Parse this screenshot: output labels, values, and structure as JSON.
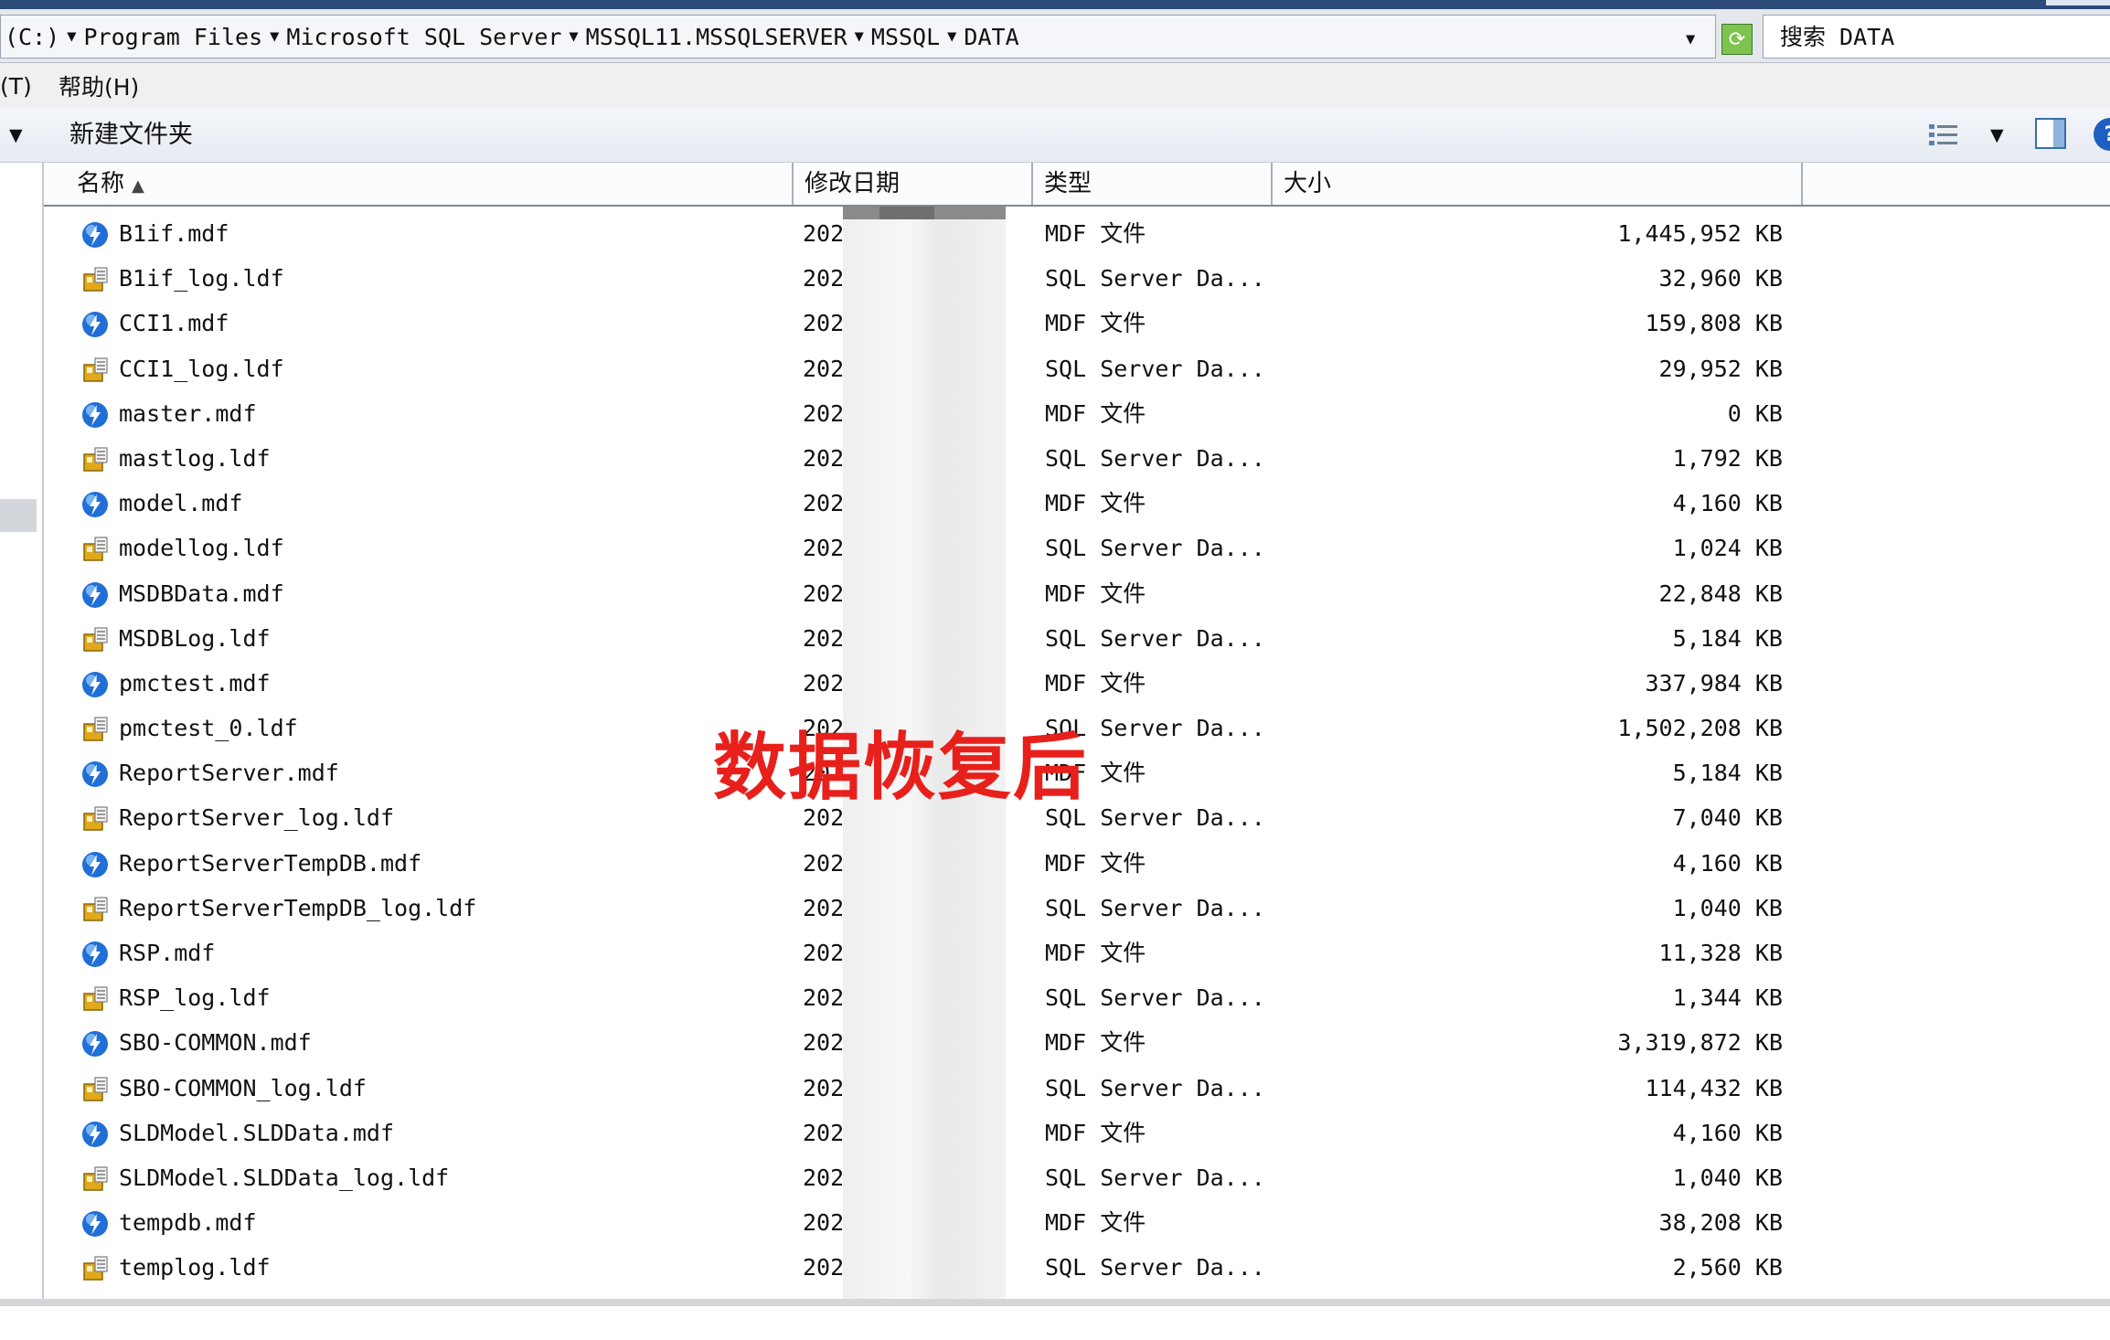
{
  "address": {
    "crumbs": [
      "(C:)",
      "Program Files",
      "Microsoft SQL Server",
      "MSSQL11.MSSQLSERVER",
      "MSSQL",
      "DATA"
    ]
  },
  "search": {
    "value": "搜索 DATA"
  },
  "menu": {
    "tools": "(T)",
    "help": "帮助(H)"
  },
  "toolbar": {
    "new_folder": "新建文件夹"
  },
  "columns": {
    "name": "名称",
    "date": "修改日期",
    "type": "类型",
    "size": "大小"
  },
  "files": [
    {
      "name": "B1if.mdf",
      "date": "202",
      "type": "MDF 文件",
      "size": "1,445,952 KB",
      "icon": "mdf-database-icon"
    },
    {
      "name": "B1if_log.ldf",
      "date": "202",
      "type": "SQL Server Da...",
      "size": "32,960 KB",
      "icon": "ldf-log-icon"
    },
    {
      "name": "CCI1.mdf",
      "date": "202",
      "type": "MDF 文件",
      "size": "159,808 KB",
      "icon": "mdf-database-icon"
    },
    {
      "name": "CCI1_log.ldf",
      "date": "202",
      "type": "SQL Server Da...",
      "size": "29,952 KB",
      "icon": "ldf-log-icon"
    },
    {
      "name": "master.mdf",
      "date": "202",
      "type": "MDF 文件",
      "size": "0 KB",
      "icon": "mdf-database-icon"
    },
    {
      "name": "mastlog.ldf",
      "date": "202",
      "type": "SQL Server Da...",
      "size": "1,792 KB",
      "icon": "ldf-log-icon"
    },
    {
      "name": "model.mdf",
      "date": "202",
      "type": "MDF 文件",
      "size": "4,160 KB",
      "icon": "mdf-database-icon"
    },
    {
      "name": "modellog.ldf",
      "date": "202",
      "type": "SQL Server Da...",
      "size": "1,024 KB",
      "icon": "ldf-log-icon"
    },
    {
      "name": "MSDBData.mdf",
      "date": "202",
      "type": "MDF 文件",
      "size": "22,848 KB",
      "icon": "mdf-database-icon"
    },
    {
      "name": "MSDBLog.ldf",
      "date": "202",
      "type": "SQL Server Da...",
      "size": "5,184 KB",
      "icon": "ldf-log-icon"
    },
    {
      "name": "pmctest.mdf",
      "date": "202",
      "type": "MDF 文件",
      "size": "337,984 KB",
      "icon": "mdf-database-icon"
    },
    {
      "name": "pmctest_0.ldf",
      "date": "202",
      "type": "SQL Server Da...",
      "size": "1,502,208 KB",
      "icon": "ldf-log-icon"
    },
    {
      "name": "ReportServer.mdf",
      "date": "202",
      "type": "MDF 文件",
      "size": "5,184 KB",
      "icon": "mdf-database-icon"
    },
    {
      "name": "ReportServer_log.ldf",
      "date": "202",
      "type": "SQL Server Da...",
      "size": "7,040 KB",
      "icon": "ldf-log-icon"
    },
    {
      "name": "ReportServerTempDB.mdf",
      "date": "202",
      "type": "MDF 文件",
      "size": "4,160 KB",
      "icon": "mdf-database-icon"
    },
    {
      "name": "ReportServerTempDB_log.ldf",
      "date": "202",
      "type": "SQL Server Da...",
      "size": "1,040 KB",
      "icon": "ldf-log-icon"
    },
    {
      "name": "RSP.mdf",
      "date": "202",
      "type": "MDF 文件",
      "size": "11,328 KB",
      "icon": "mdf-database-icon"
    },
    {
      "name": "RSP_log.ldf",
      "date": "202",
      "type": "SQL Server Da...",
      "size": "1,344 KB",
      "icon": "ldf-log-icon"
    },
    {
      "name": "SBO-COMMON.mdf",
      "date": "202",
      "type": "MDF 文件",
      "size": "3,319,872 KB",
      "icon": "mdf-database-icon"
    },
    {
      "name": "SBO-COMMON_log.ldf",
      "date": "202",
      "type": "SQL Server Da...",
      "size": "114,432 KB",
      "icon": "ldf-log-icon"
    },
    {
      "name": "SLDModel.SLDData.mdf",
      "date": "202",
      "type": "MDF 文件",
      "size": "4,160 KB",
      "icon": "mdf-database-icon"
    },
    {
      "name": "SLDModel.SLDData_log.ldf",
      "date": "202",
      "type": "SQL Server Da...",
      "size": "1,040 KB",
      "icon": "ldf-log-icon"
    },
    {
      "name": "tempdb.mdf",
      "date": "202",
      "type": "MDF 文件",
      "size": "38,208 KB",
      "icon": "mdf-database-icon"
    },
    {
      "name": "templog.ldf",
      "date": "202",
      "type": "SQL Server Da...",
      "size": "2,560 KB",
      "icon": "ldf-log-icon"
    }
  ],
  "overlay_text": "数据恢复后",
  "colors": {
    "overlay": "#e8201c",
    "mdf_icon": "#1f6fd6",
    "ldf_icon": "#e0a81a"
  }
}
